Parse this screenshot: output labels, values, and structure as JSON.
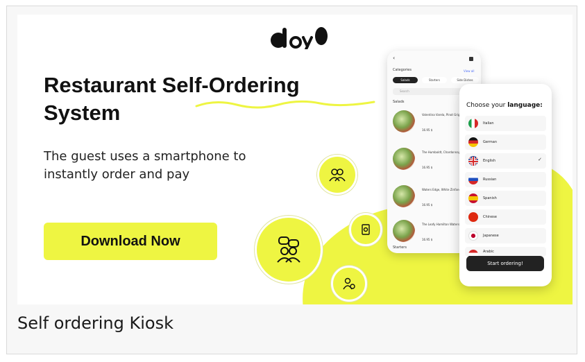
{
  "banner": {
    "logo_text": "doyo",
    "headline_line1": "Restaurant Self-Ordering",
    "headline_line2": "System",
    "subhead_line1": "The guest uses a smartphone to",
    "subhead_line2": "instantly order and pay",
    "download_label": "Download Now",
    "accent_color": "#eef542"
  },
  "menu_phone": {
    "categories_label": "Categories",
    "view_all": "View all",
    "tabs": [
      "Salads",
      "Starters",
      "Side Dishes"
    ],
    "search_placeholder": "Search",
    "section_salads": "Salads",
    "section_starters": "Starters",
    "items": [
      {
        "name": "Valentina Varela, Pinot Grigio",
        "price": "16.95 $"
      },
      {
        "name": "The Humboldt, Chardonnay",
        "price": "16.95 $"
      },
      {
        "name": "Waters Edge, White Zinfandel",
        "price": "16.95 $"
      },
      {
        "name": "The Leafy Hamilton Waters Edge",
        "price": "16.95 $"
      }
    ]
  },
  "language_phone": {
    "title_prefix": "Choose your",
    "title_bold": "language:",
    "languages": [
      "Italian",
      "German",
      "English",
      "Russian",
      "Spanish",
      "Chinese",
      "Japanese",
      "Arabic"
    ],
    "selected": "English",
    "start_label": "Start ordering!"
  },
  "caption": "Self ordering Kiosk"
}
